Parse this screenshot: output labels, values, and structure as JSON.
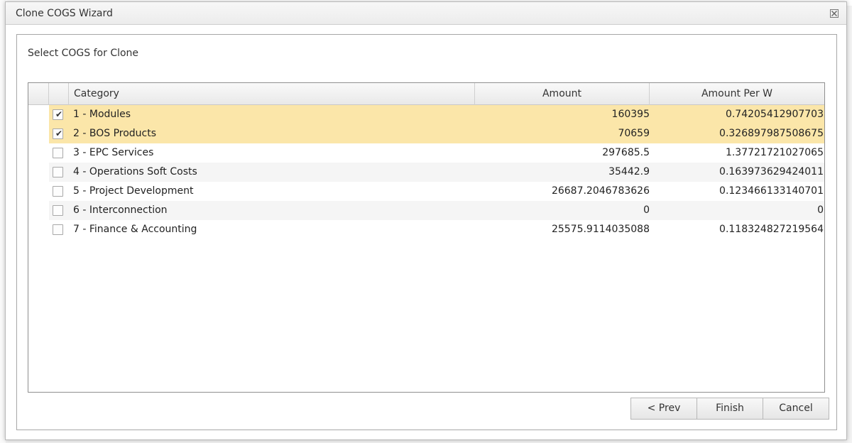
{
  "dialog": {
    "title": "Clone COGS Wizard",
    "subtitle": "Select COGS for Clone"
  },
  "grid": {
    "columns": {
      "category": "Category",
      "amount": "Amount",
      "amount_per_w": "Amount Per W"
    },
    "rows": [
      {
        "checked": true,
        "category": "1 - Modules",
        "amount": "160395",
        "amount_per_w": "0.74205412907703"
      },
      {
        "checked": true,
        "category": "2 - BOS Products",
        "amount": "70659",
        "amount_per_w": "0.326897987508675"
      },
      {
        "checked": false,
        "category": "3 - EPC Services",
        "amount": "297685.5",
        "amount_per_w": "1.37721721027065"
      },
      {
        "checked": false,
        "category": "4 - Operations Soft Costs",
        "amount": "35442.9",
        "amount_per_w": "0.163973629424011"
      },
      {
        "checked": false,
        "category": "5 - Project Development",
        "amount": "26687.2046783626",
        "amount_per_w": "0.123466133140701"
      },
      {
        "checked": false,
        "category": "6 - Interconnection",
        "amount": "0",
        "amount_per_w": "0"
      },
      {
        "checked": false,
        "category": "7 - Finance & Accounting",
        "amount": "25575.9114035088",
        "amount_per_w": "0.118324827219564"
      }
    ]
  },
  "buttons": {
    "prev": "< Prev",
    "finish": "Finish",
    "cancel": "Cancel"
  },
  "colors": {
    "selected_row": "#fbe6a9",
    "alt_row": "#f5f5f5"
  },
  "icons": {
    "close": "close-icon",
    "check": "checkmark-icon"
  }
}
